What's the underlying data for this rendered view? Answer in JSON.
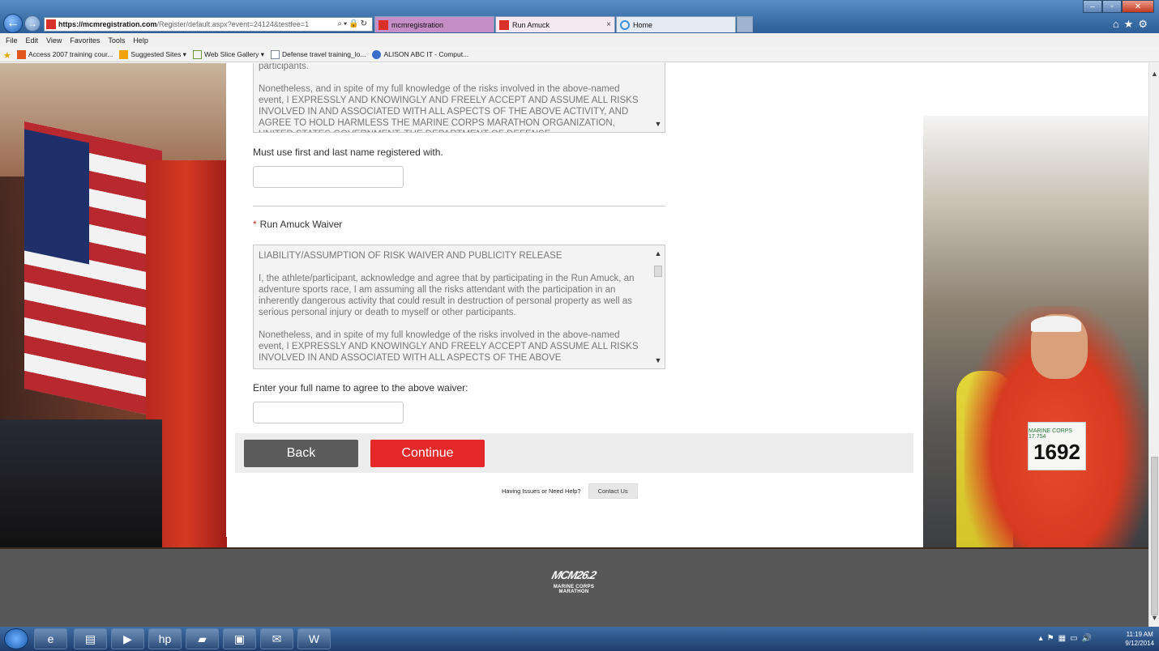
{
  "browser": {
    "address": {
      "host": "https://mcmregistration.com",
      "path": "/Register/default.aspx?event=24124&testfee=1"
    },
    "tabs": [
      {
        "label": "mcmregistration"
      },
      {
        "label": "Run Amuck",
        "close": "×"
      },
      {
        "label": "Home"
      }
    ],
    "menu": [
      "File",
      "Edit",
      "View",
      "Favorites",
      "Tools",
      "Help"
    ],
    "favorites": [
      "Access 2007 training cour...",
      "Suggested Sites ▾",
      "Web Slice Gallery ▾",
      "Defense travel training_lo...",
      "ALISON ABC IT - Comput..."
    ]
  },
  "form": {
    "waiver1_text": [
      "participants.",
      "Nonetheless, and in spite of my full knowledge of the risks involved in the above-named event, I EXPRESSLY AND KNOWINGLY AND FREELY ACCEPT AND ASSUME ALL RISKS INVOLVED IN AND ASSOCIATED WITH ALL ASPECTS OF THE ABOVE ACTIVITY, AND AGREE TO HOLD HARMLESS THE MARINE CORPS MARATHON ORGANIZATION, UNITED STATES GOVERNMENT, THE DEPARTMENT OF DEFENSE"
    ],
    "name_note": "Must use first and last name registered with.",
    "waiver2_required": "*",
    "waiver2_label": "Run Amuck Waiver",
    "waiver2_text": [
      "LIABILITY/ASSUMPTION OF RISK WAIVER AND PUBLICITY RELEASE",
      "I, the athlete/participant, acknowledge and agree that by participating in the Run Amuck, an adventure sports race, I am assuming all the risks attendant with the participation in an inherently dangerous activity that could result in destruction of personal property as well as serious personal injury or death to myself or other participants.",
      "Nonetheless, and in spite of my full knowledge of the risks involved in the above-named event, I EXPRESSLY AND KNOWINGLY AND FREELY ACCEPT AND ASSUME ALL RISKS INVOLVED IN AND ASSOCIATED WITH ALL ASPECTS OF THE ABOVE"
    ],
    "agree_label": "Enter your full name to agree to the above waiver:",
    "back_label": "Back",
    "continue_label": "Continue",
    "help_text": "Having Issues or Need Help?",
    "contact_label": "Contact Us"
  },
  "background": {
    "bib_top": "MARINE CORPS 17.754",
    "bib_number": "1692"
  },
  "footer": {
    "logo_mark": "MCM26.2",
    "logo_text": "MARINE CORPS MARATHON"
  },
  "taskbar": {
    "time": "11:19 AM",
    "date": "9/12/2014"
  },
  "colors": {
    "accent_red": "#e5282a",
    "back_gray": "#5b5b5b",
    "footer_gray": "#585858"
  }
}
